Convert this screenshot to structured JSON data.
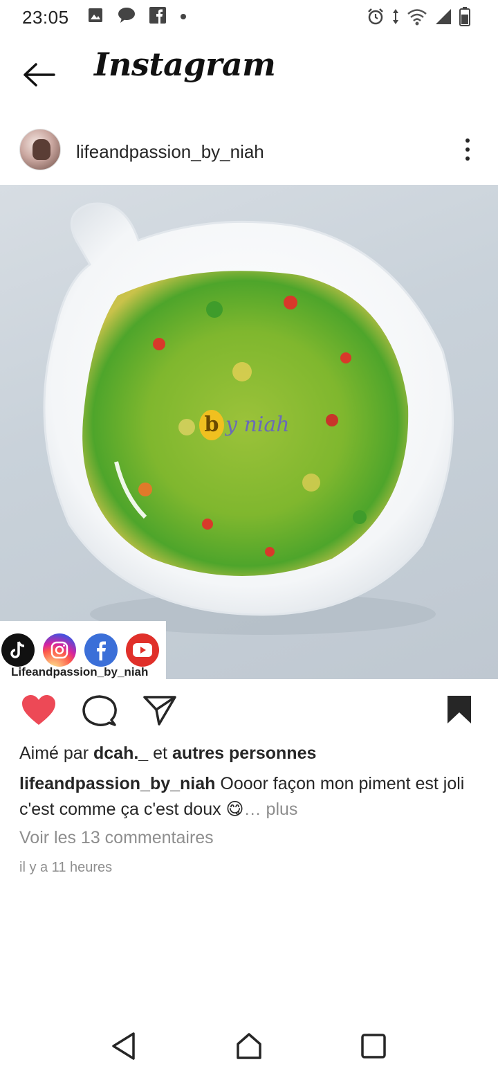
{
  "status_bar": {
    "time": "23:05",
    "left_icons": [
      "image-icon",
      "chat-bubble-icon",
      "facebook-icon",
      "dot-icon"
    ],
    "right_icons": [
      "alarm-icon",
      "data-arrows-icon",
      "wifi-icon",
      "signal-icon",
      "battery-icon"
    ]
  },
  "appbar": {
    "back_icon": "arrow-left-icon",
    "logo_text": "Instagram"
  },
  "post": {
    "username": "lifeandpassion_by_niah",
    "more_icon": "more-vertical-icon",
    "image": {
      "overlay_text": "y niah",
      "overlay_letter": "b",
      "social_handle": "Lifeandpassion_by_niah",
      "social_icons": [
        "tiktok-icon",
        "instagram-icon",
        "facebook-icon",
        "youtube-icon"
      ]
    },
    "actions": {
      "liked": true,
      "like_color": "#ed4956"
    },
    "likes": {
      "prefix": "Aimé par",
      "user": "dcah._",
      "conjunction": "et",
      "others": "autres personnes"
    },
    "caption": {
      "user": "lifeandpassion_by_niah",
      "text": "Oooor façon mon piment est joli c'est comme ça c'est doux 😋",
      "more": "… plus"
    },
    "view_comments": "Voir les 13 commentaires",
    "timestamp": "il y a 11 heures"
  },
  "navbar": {
    "icons": [
      "nav-back-icon",
      "nav-home-icon",
      "nav-recents-icon"
    ]
  }
}
